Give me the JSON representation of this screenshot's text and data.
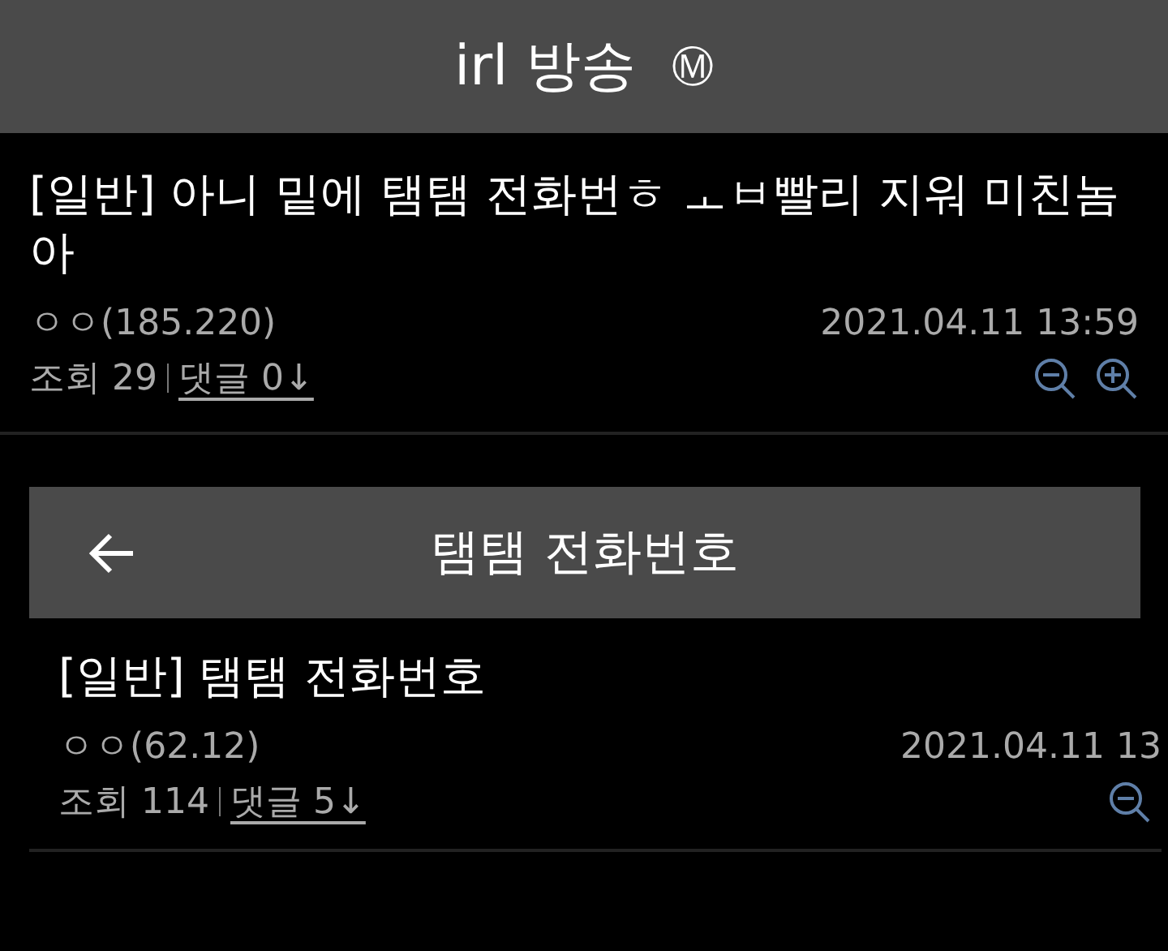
{
  "header": {
    "title": "irl 방송",
    "badge": "Ⓜ"
  },
  "post": {
    "title": "[일반] 아니 밑에 탬탬 전화번ㅎ ㅗㅂ빨리 지워 미친놈아",
    "author": "ㅇㅇ(185.220)",
    "date": "2021.04.11 13:59",
    "views": "조회 29",
    "comments": "댓글 0↓",
    "tools": [
      {
        "kind": "zoom_out"
      },
      {
        "kind": "zoom_in"
      }
    ]
  },
  "embedded": {
    "bar": {
      "title": "탬탬 전화번호"
    },
    "post": {
      "title": "[일반] 탬탬 전화번호",
      "author": "ㅇㅇ(62.12)",
      "date": "2021.04.11 13",
      "views": "조회 114",
      "comments": "댓글 5↓",
      "tools": [
        {
          "kind": "zoom_out"
        }
      ]
    }
  }
}
